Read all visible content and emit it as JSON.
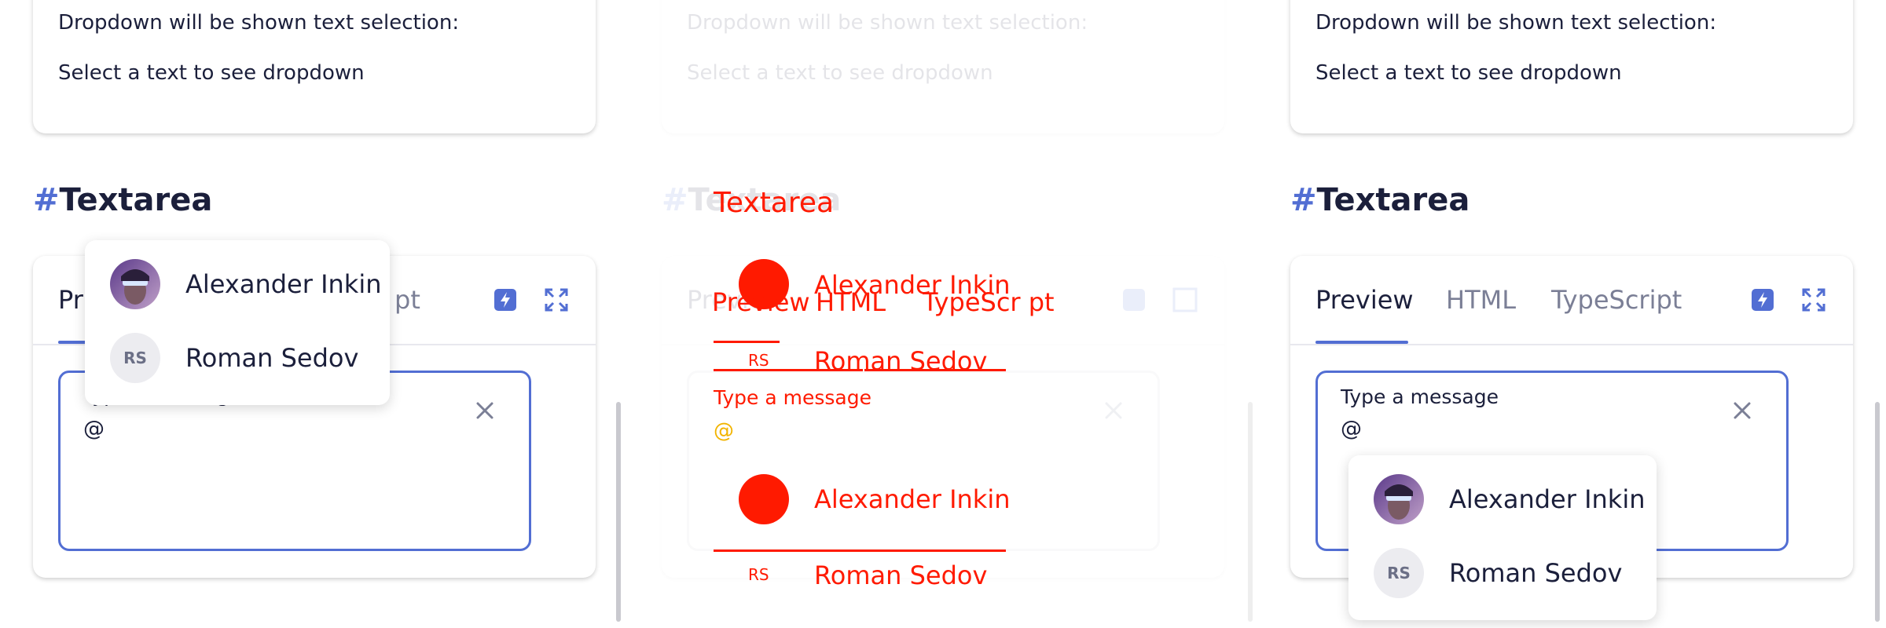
{
  "dropdown_card": {
    "line1": "Dropdown will be shown text selection:",
    "line2": "Select a text to see dropdown"
  },
  "section": {
    "hash": "#",
    "title": "Textarea"
  },
  "tabs": {
    "preview": "Preview",
    "html": "HTML",
    "typescript": "TypeScript",
    "left_preview_partial": "Pr",
    "left_typescript_partial": "pt",
    "mid_typescript_glitch": "TypeScr pt"
  },
  "textarea": {
    "placeholder": "Type a message",
    "value": "@"
  },
  "mentions": {
    "items": [
      {
        "name": "Alexander Inkin",
        "avatar": "photo"
      },
      {
        "name": "Roman Sedov",
        "initials": "RS"
      }
    ]
  },
  "colors": {
    "accent": "#526ed3",
    "text": "#1b1f3b",
    "muted": "#7b7f96",
    "overlay_red": "#ff1a00"
  },
  "icons": [
    "lightning-icon",
    "expand-icon",
    "close-icon"
  ]
}
